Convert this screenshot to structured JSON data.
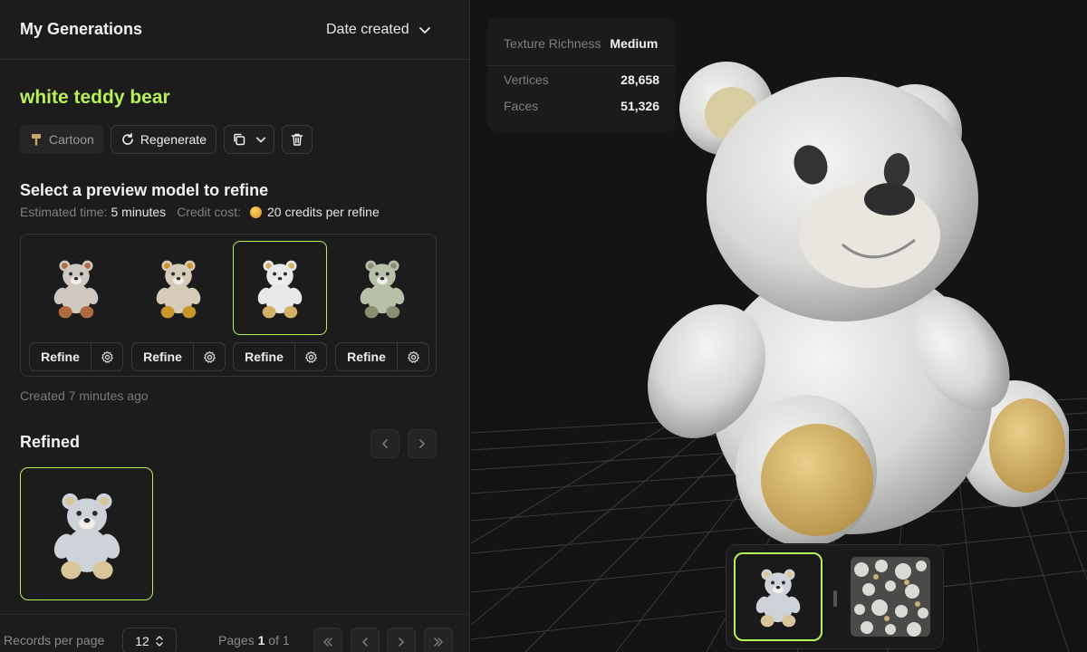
{
  "header": {
    "title": "My Generations",
    "sort_label": "Date created"
  },
  "generation": {
    "prompt": "white teddy bear",
    "style_label": "Cartoon",
    "regenerate_label": "Regenerate"
  },
  "preview": {
    "title": "Select a preview model to refine",
    "est_time_label": "Estimated time:",
    "est_time_value": "5 minutes",
    "credit_label": "Credit cost:",
    "credit_value": "20 credits per refine",
    "refine_label": "Refine",
    "created": "Created 7 minutes ago",
    "selected_index": 2
  },
  "refined": {
    "title": "Refined"
  },
  "footer": {
    "records_label": "Records per page",
    "records_value": "12",
    "pages_label": "Pages",
    "page_current": "1",
    "page_of": "of 1"
  },
  "viewer": {
    "texture_label": "Texture Richness",
    "texture_value": "Medium",
    "vertices_label": "Vertices",
    "vertices_value": "28,658",
    "faces_label": "Faces",
    "faces_value": "51,326"
  },
  "colors": {
    "accent": "#b8f05a",
    "background": "#1c1c1c",
    "viewer_bg": "#141414"
  }
}
